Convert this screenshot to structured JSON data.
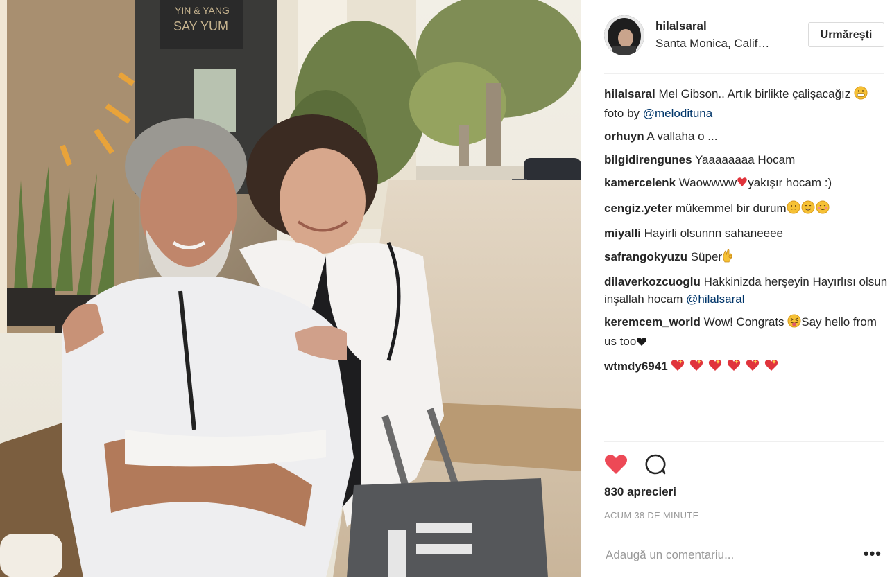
{
  "post": {
    "username": "hilalsaral",
    "location": "Santa Monica, Calif…",
    "follow_label": "Urmărești"
  },
  "photo": {
    "sign_line1": "YIN & YANG",
    "sign_line2": "SAY YUM",
    "bag_text": "H"
  },
  "caption": {
    "user": "hilalsaral",
    "text1": "Mel Gibson.. Artık birlikte çalişacağız ",
    "text2": " foto by ",
    "mention": "@melodituna"
  },
  "comments": [
    {
      "user": "orhuyn",
      "text": "A vallaha o ..."
    },
    {
      "user": "bilgidirengunes",
      "text": "Yaaaaaaaa Hocam"
    },
    {
      "user": "kamercelenk",
      "text_a": "Waowwww",
      "text_b": "yakışır hocam :)"
    },
    {
      "user": "cengiz.yeter",
      "text": "mükemmel bir durum"
    },
    {
      "user": "miyalli",
      "text": "Hayirli olsunnn sahaneeee"
    },
    {
      "user": "safrangokyuzu",
      "text": "Süper"
    },
    {
      "user": "dilaverkozcuoglu",
      "text": "Hakkinizda herşeyin Hayırlısı olsun inşallah hocam ",
      "mention": "@hilalsaral"
    },
    {
      "user": "keremcem_world",
      "text_a": "Wow! Congrats ",
      "text_b": "Say hello from us too"
    },
    {
      "user": "wtmdy6941",
      "text": ""
    }
  ],
  "stats": {
    "likes": "830 aprecieri",
    "time": "ACUM 38 DE MINUTE"
  },
  "add_comment": {
    "placeholder": "Adaugă un comentariu...",
    "more": "•••"
  },
  "icons": {
    "like": "heart-icon",
    "comment": "comment-bubble-icon",
    "more": "ellipsis-icon"
  },
  "colors": {
    "heart": "#ed4956",
    "mention": "#003569",
    "muted": "#999999",
    "divider": "#efefef"
  }
}
